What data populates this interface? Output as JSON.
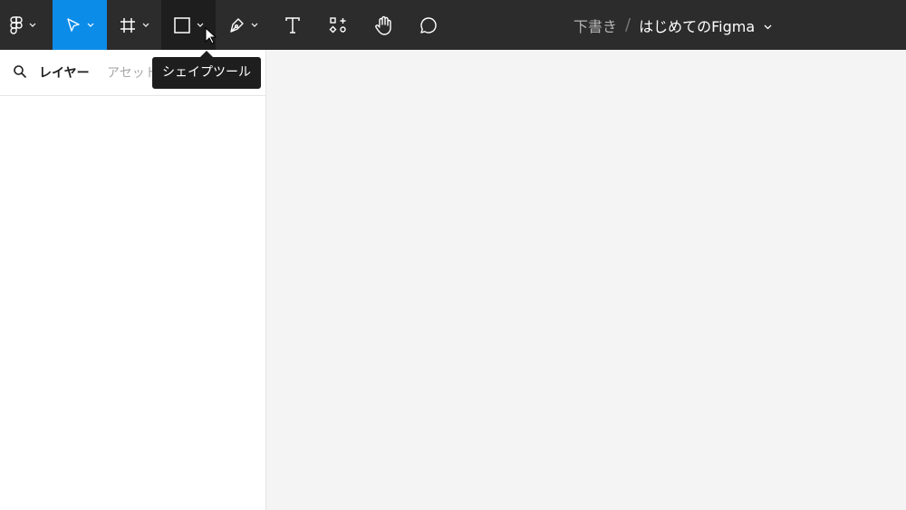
{
  "toolbar": {
    "tools": [
      {
        "id": "main-menu",
        "icon": "figma-logo-icon",
        "has_dropdown": true
      },
      {
        "id": "move",
        "icon": "move-arrow-icon",
        "has_dropdown": true,
        "active": true
      },
      {
        "id": "frame",
        "icon": "frame-hash-icon",
        "has_dropdown": true
      },
      {
        "id": "shape",
        "icon": "rectangle-icon",
        "has_dropdown": true,
        "pressed": true
      },
      {
        "id": "pen",
        "icon": "pen-icon",
        "has_dropdown": true
      },
      {
        "id": "text",
        "icon": "text-icon"
      },
      {
        "id": "resources",
        "icon": "resources-icon"
      },
      {
        "id": "hand",
        "icon": "hand-icon"
      },
      {
        "id": "comment",
        "icon": "comment-icon"
      }
    ],
    "active_color": "#0c8ce9",
    "background_color": "#2c2c2c"
  },
  "title": {
    "location": "下書き",
    "separator": "/",
    "filename": "はじめてのFigma"
  },
  "sidebar": {
    "tabs": {
      "layers": "レイヤー",
      "assets": "アセット"
    }
  },
  "tooltip": {
    "text": "シェイプツール"
  }
}
